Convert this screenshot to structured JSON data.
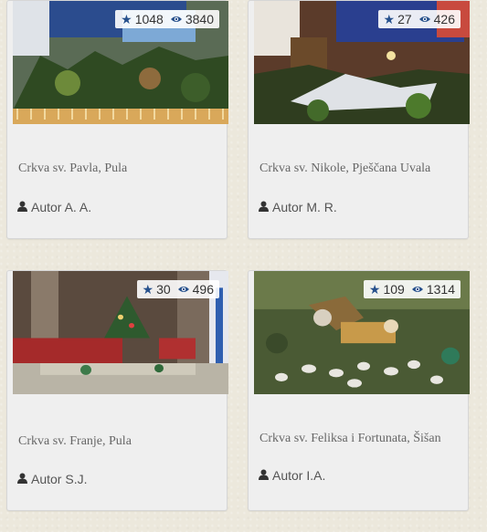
{
  "colors": {
    "accent": "#26508c",
    "card_bg": "#efefef",
    "page_bg": "#ece8dc"
  },
  "cards": [
    {
      "title": "Crkva sv. Pavla, Pula",
      "author": "Autor A. A.",
      "stars": "1048",
      "views": "3840",
      "icons": [
        "star-icon",
        "eye-icon",
        "user-icon"
      ]
    },
    {
      "title": "Crkva sv. Nikole, Pješčana Uvala",
      "author": "Autor M. R.",
      "stars": "27",
      "views": "426",
      "icons": [
        "star-icon",
        "eye-icon",
        "user-icon"
      ]
    },
    {
      "title": "Crkva sv. Franje, Pula",
      "author": "Autor S.J.",
      "stars": "30",
      "views": "496",
      "icons": [
        "star-icon",
        "eye-icon",
        "user-icon"
      ]
    },
    {
      "title": "Crkva sv. Feliksa i Fortunata, Šišan",
      "author": "Autor I.A.",
      "stars": "109",
      "views": "1314",
      "icons": [
        "star-icon",
        "eye-icon",
        "user-icon"
      ]
    }
  ]
}
